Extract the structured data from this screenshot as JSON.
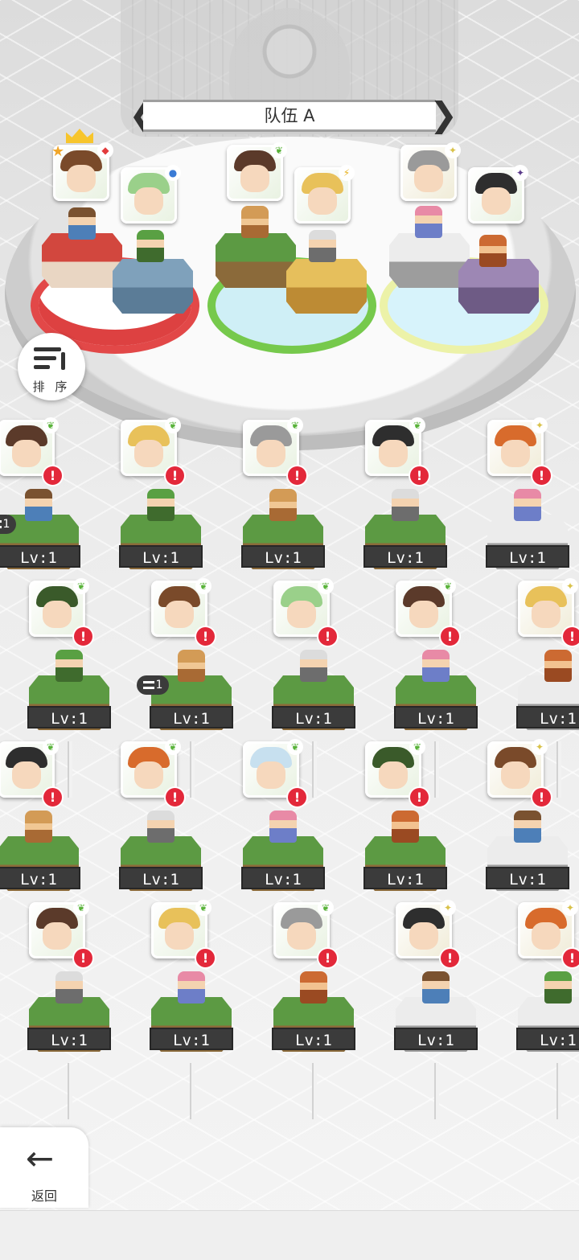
{
  "team": {
    "title": "队伍 A",
    "prev_label": "❮",
    "next_label": "❯"
  },
  "sort_button": {
    "label": "排 序",
    "icon": "sort-list-icon"
  },
  "back_button": {
    "label": "返回",
    "arrow": "←",
    "icon": "back-arrow-icon"
  },
  "lv_label": "Lv:1",
  "stack_count": "1",
  "alert_mark": "!",
  "colors": {
    "accent_red": "#e3283a",
    "lv_badge": "#3b3b3b",
    "grass": "#5c9a43",
    "stone": "#ececec",
    "team_red": "#e24848",
    "team_green": "#76c94c",
    "team_yellow": "#ecf2a8"
  },
  "lineup": [
    {
      "slot": "leader",
      "element": "fire",
      "element_icon": "diamond-icon",
      "leader_crown": true,
      "leader_star": true
    },
    {
      "slot": "2",
      "element": "water",
      "element_icon": "circle-icon"
    },
    {
      "slot": "3",
      "element": "wind",
      "element_icon": "leaf-icon"
    },
    {
      "slot": "4",
      "element": "thunder",
      "element_icon": "bolt-icon"
    },
    {
      "slot": "5",
      "element": "light",
      "element_icon": "sparkle-icon"
    },
    {
      "slot": "6",
      "element": "dark",
      "element_icon": "star-icon"
    }
  ],
  "roster": {
    "rows": [
      {
        "units": [
          "wind",
          "wind",
          "wind",
          "wind",
          "light",
          "light"
        ]
      },
      {
        "units": [
          "wind",
          "wind",
          "wind",
          "wind",
          "light"
        ]
      },
      {
        "units": [
          "wind",
          "wind",
          "wind",
          "wind",
          "light",
          "light"
        ]
      },
      {
        "units": [
          "wind",
          "wind",
          "wind",
          "light",
          "light"
        ]
      }
    ],
    "stack_badges_on": [
      "row1-unit1",
      "row2-unit2"
    ]
  }
}
